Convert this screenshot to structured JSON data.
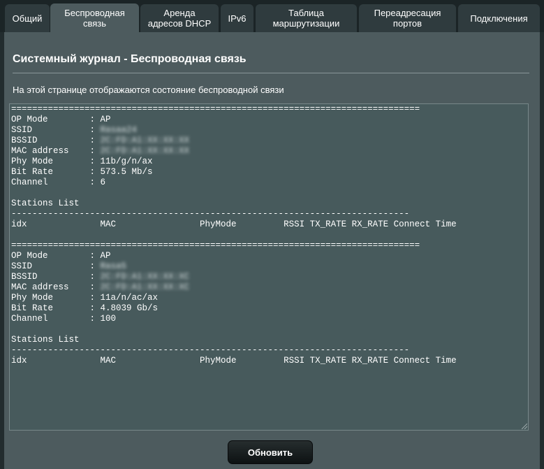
{
  "tabs": [
    {
      "label": "Общий"
    },
    {
      "label": "Беспроводная\nсвязь",
      "active": true
    },
    {
      "label": "Аренда\nадресов DHCP"
    },
    {
      "label": "IPv6"
    },
    {
      "label": "Таблица\nмаршрутизации"
    },
    {
      "label": "Переадресация\nпортов"
    },
    {
      "label": "Подключения"
    }
  ],
  "page": {
    "title": "Системный журнал - Беспроводная связь",
    "description": "На этой странице отображаются состояние беспроводной связи"
  },
  "log": {
    "separator": "==============================================================================",
    "sections": [
      {
        "op_mode": {
          "key": "OP Mode",
          "value": "AP"
        },
        "ssid": {
          "key": "SSID",
          "value": "Rasaa24"
        },
        "bssid": {
          "key": "BSSID",
          "value": "2C:FD:A1:XX:XX:XX"
        },
        "mac": {
          "key": "MAC address",
          "value": "2C:FD:A1:XX:XX:XX"
        },
        "phy_mode": {
          "key": "Phy Mode",
          "value": "11b/g/n/ax"
        },
        "bit_rate": {
          "key": "Bit Rate",
          "value": "573.5 Mb/s"
        },
        "channel": {
          "key": "Channel",
          "value": "6"
        },
        "stations_title": "Stations List",
        "stations_divider": "----------------------------------------------------------------------------",
        "stations_header": "idx              MAC                PhyMode         RSSI TX_RATE RX_RATE Connect Time"
      },
      {
        "op_mode": {
          "key": "OP Mode",
          "value": "AP"
        },
        "ssid": {
          "key": "SSID",
          "value": "Rasa5"
        },
        "bssid": {
          "key": "BSSID",
          "value": "2C:FD:A1:XX:XX:XC"
        },
        "mac": {
          "key": "MAC address",
          "value": "2C:FD:A1:XX:XX:XC"
        },
        "phy_mode": {
          "key": "Phy Mode",
          "value": "11a/n/ac/ax"
        },
        "bit_rate": {
          "key": "Bit Rate",
          "value": "4.8039 Gb/s"
        },
        "channel": {
          "key": "Channel",
          "value": "100"
        },
        "stations_title": "Stations List",
        "stations_divider": "----------------------------------------------------------------------------",
        "stations_header": "idx              MAC                PhyMode         RSSI TX_RATE RX_RATE Connect Time"
      }
    ]
  },
  "buttons": {
    "refresh": "Обновить"
  }
}
